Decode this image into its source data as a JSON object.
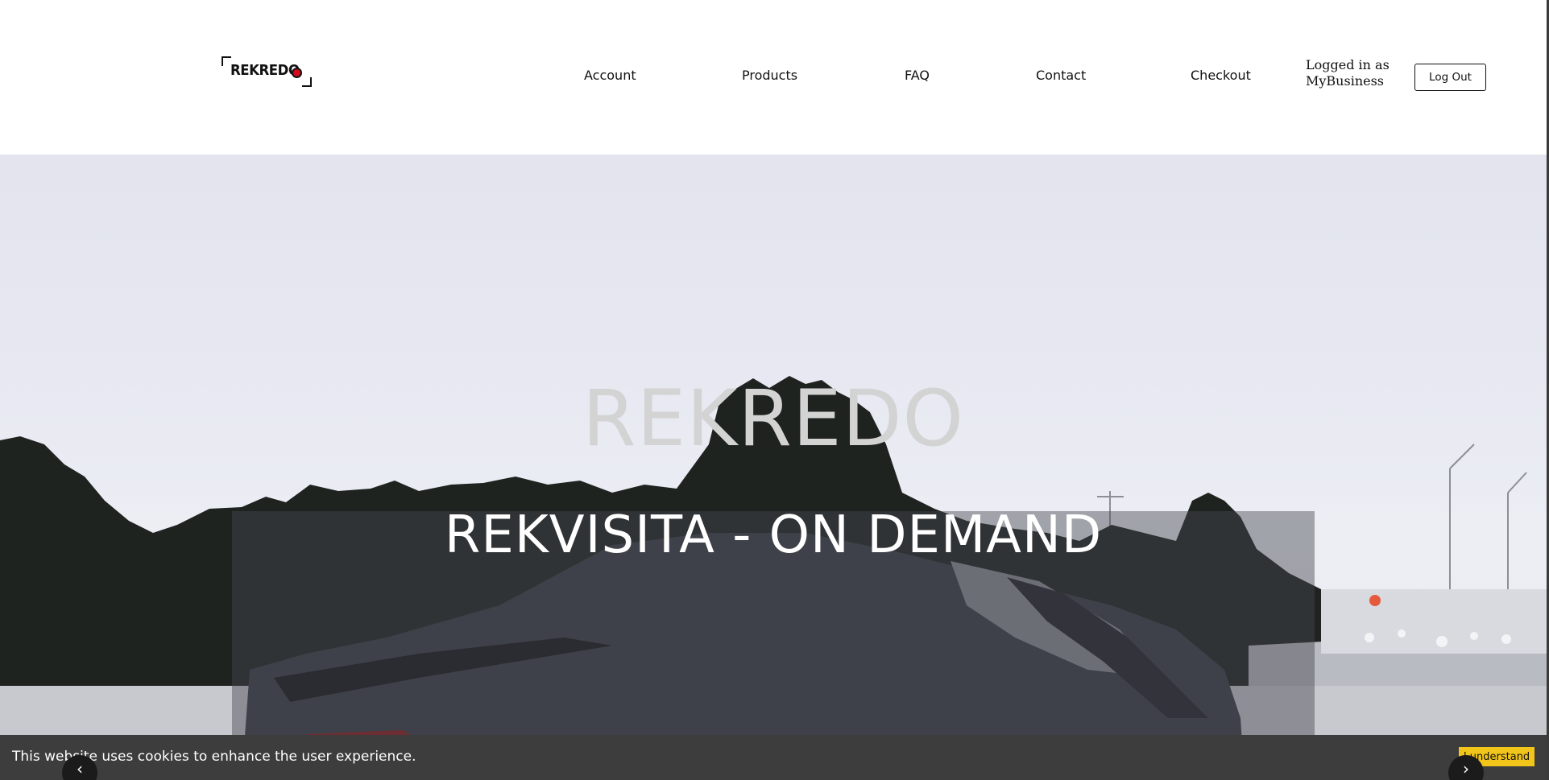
{
  "header": {
    "logo_text": "REKREDO",
    "nav": {
      "account": "Account",
      "products": "Products",
      "faq": "FAQ",
      "contact": "Contact",
      "checkout": "Checkout"
    },
    "logged_in": "Logged in as MyBusiness",
    "logout_label": "Log Out"
  },
  "hero": {
    "title": "REKREDO",
    "subtitle": "REKVISITA - ON DEMAND"
  },
  "cookie": {
    "text": "This website uses cookies to enhance the user experience.",
    "button_label": "I understand"
  },
  "slider": {
    "prev_icon": "chevron-left-icon",
    "next_icon": "chevron-right-icon"
  },
  "colors": {
    "accent_button": "#f2c51b",
    "logo_dot": "#d30a1e",
    "cookie_bar": "#3d3d3d"
  }
}
